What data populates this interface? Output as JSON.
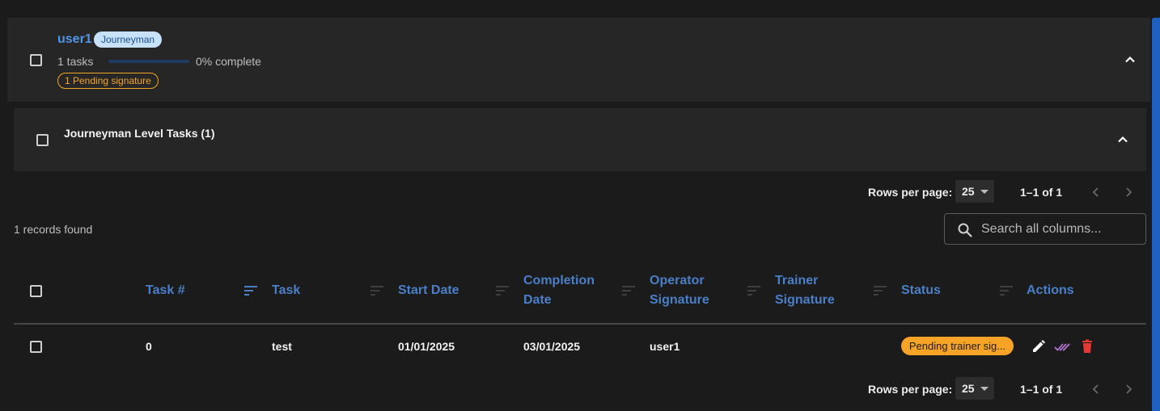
{
  "user": {
    "name": "user1",
    "level_badge": "Journeyman",
    "tasks_count": "1 tasks",
    "progress_percent": 0,
    "progress_text": "0% complete",
    "pending_badge": "1 Pending signature"
  },
  "group": {
    "title": "Journeyman Level Tasks (1)"
  },
  "pagination": {
    "rows_per_page_label": "Rows per page:",
    "rows_per_page_value": "25",
    "range": "1–1 of 1"
  },
  "records_found": "1 records found",
  "search": {
    "placeholder": "Search all columns..."
  },
  "table": {
    "headers": {
      "task_num": "Task #",
      "task": "Task",
      "start_date": "Start Date",
      "completion_line1": "Completion",
      "completion_line2": "Date",
      "operator_line1": "Operator",
      "operator_line2": "Signature",
      "trainer_line1": "Trainer",
      "trainer_line2": "Signature",
      "status": "Status",
      "actions": "Actions"
    },
    "rows": [
      {
        "task_num": "0",
        "task": "test",
        "start_date": "01/01/2025",
        "completion_date": "03/01/2025",
        "operator_signature": "user1",
        "trainer_signature": "",
        "status": "Pending trainer sig..."
      }
    ]
  },
  "colors": {
    "accent_blue": "#4f95e6",
    "pending_orange": "#f5a524",
    "delete_red": "#e53935",
    "sign_purple": "#b678d9"
  }
}
